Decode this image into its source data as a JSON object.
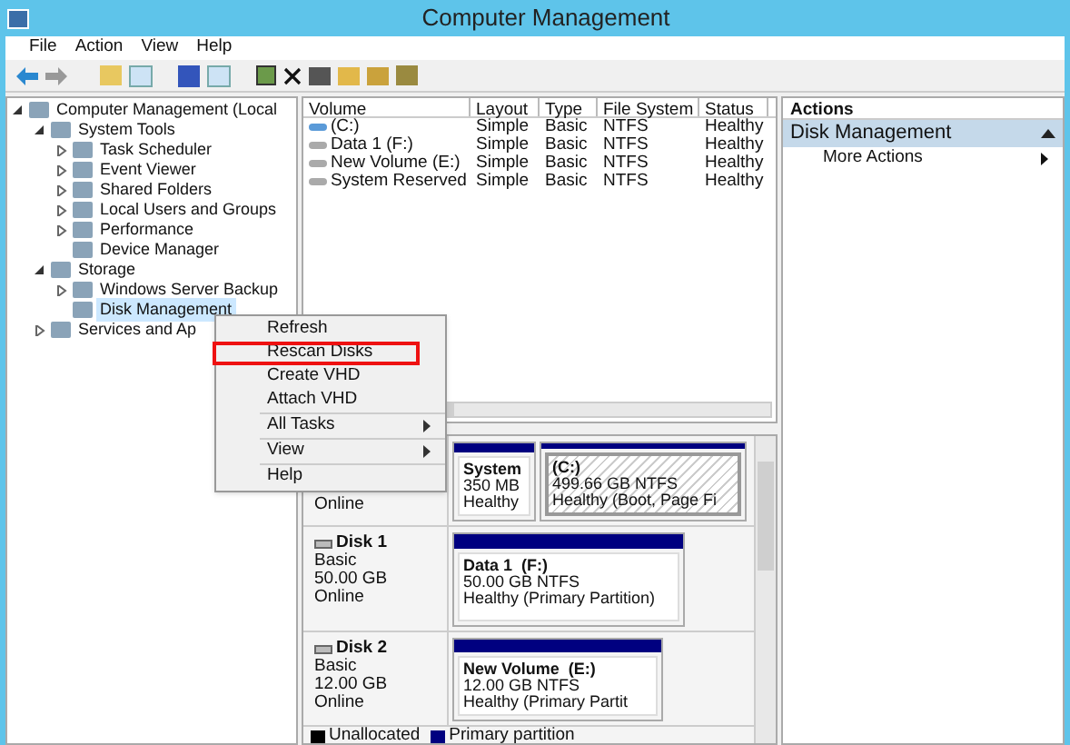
{
  "window": {
    "title": "Computer Management"
  },
  "menu": [
    "File",
    "Action",
    "View",
    "Help"
  ],
  "tree": [
    {
      "label": "Computer Management (Local",
      "expanded": true,
      "selected": false,
      "children": [
        {
          "label": "System Tools",
          "expanded": true,
          "selected": false,
          "children": [
            {
              "label": "Task Scheduler",
              "expanded": false,
              "selected": false
            },
            {
              "label": "Event Viewer",
              "expanded": false,
              "selected": false
            },
            {
              "label": "Shared Folders",
              "expanded": false,
              "selected": false
            },
            {
              "label": "Local Users and Groups",
              "expanded": false,
              "selected": false
            },
            {
              "label": "Performance",
              "expanded": false,
              "selected": false
            },
            {
              "label": "Device Manager",
              "selected": false
            }
          ]
        },
        {
          "label": "Storage",
          "expanded": true,
          "selected": false,
          "children": [
            {
              "label": "Windows Server Backup",
              "expanded": false,
              "selected": false
            },
            {
              "label": "Disk Management",
              "selected": true
            }
          ]
        },
        {
          "label": "Services and Ap",
          "expanded": false,
          "selected": false
        }
      ]
    }
  ],
  "volumes": {
    "columns": [
      "Volume",
      "Layout",
      "Type",
      "File System",
      "Status"
    ],
    "rows": [
      [
        "(C:)",
        "Simple",
        "Basic",
        "NTFS",
        "Healthy"
      ],
      [
        "Data 1 (F:)",
        "Simple",
        "Basic",
        "NTFS",
        "Healthy"
      ],
      [
        "New Volume (E:)",
        "Simple",
        "Basic",
        "NTFS",
        "Healthy"
      ],
      [
        "System Reserved",
        "Simple",
        "Basic",
        "NTFS",
        "Healthy"
      ]
    ]
  },
  "disks": [
    {
      "status": "Online",
      "partitions": [
        {
          "name": "System",
          "size": "350 MB",
          "health": "Healthy",
          "selected": false
        },
        {
          "name": "(C:)",
          "size": "499.66 GB NTFS",
          "health": "Healthy (Boot, Page Fi",
          "selected": true
        }
      ]
    },
    {
      "name": "Disk 1",
      "type": "Basic",
      "size": "50.00 GB",
      "status": "Online",
      "partitions": [
        {
          "name": "Data 1  (F:)",
          "size": "50.00 GB NTFS",
          "health": "Healthy (Primary Partition)",
          "selected": false
        }
      ]
    },
    {
      "name": "Disk 2",
      "type": "Basic",
      "size": "12.00 GB",
      "status": "Online",
      "partitions": [
        {
          "name": "New Volume  (E:)",
          "size": "12.00 GB NTFS",
          "health": "Healthy (Primary Partit",
          "selected": false
        }
      ]
    }
  ],
  "legend": [
    {
      "label": "Unallocated",
      "color": "#000000"
    },
    {
      "label": "Primary partition",
      "color": "#000080"
    }
  ],
  "actions": {
    "title": "Actions",
    "section": "Disk Management",
    "items": [
      "More Actions"
    ]
  },
  "context_menu": [
    {
      "label": "Refresh",
      "submenu": false,
      "highlighted": false,
      "separator_after": false
    },
    {
      "label": "Rescan Disks",
      "submenu": false,
      "highlighted": true,
      "separator_after": false
    },
    {
      "label": "Create VHD",
      "submenu": false,
      "highlighted": false,
      "separator_after": false
    },
    {
      "label": "Attach VHD",
      "submenu": false,
      "highlighted": false,
      "separator_after": true
    },
    {
      "label": "All Tasks",
      "submenu": true,
      "highlighted": false,
      "separator_after": true
    },
    {
      "label": "View",
      "submenu": true,
      "highlighted": false,
      "separator_after": true
    },
    {
      "label": "Help",
      "submenu": false,
      "highlighted": false,
      "separator_after": false
    }
  ]
}
